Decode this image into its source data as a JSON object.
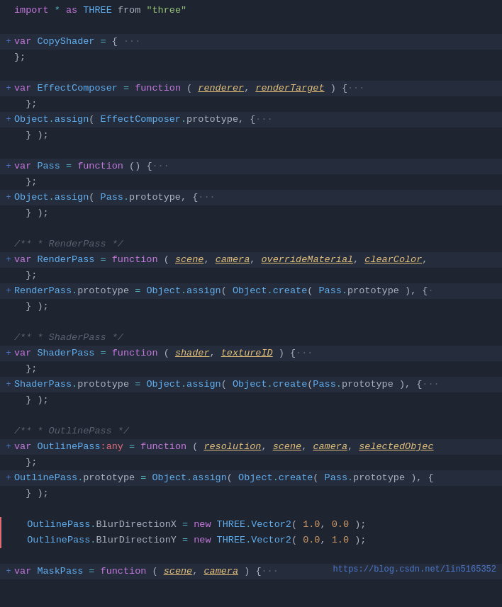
{
  "editor": {
    "background": "#1e2430",
    "lines": [
      {
        "id": "line-1",
        "toggle": "",
        "content": "import_keyword",
        "highlighted": false
      }
    ],
    "url": "https://blog.csdn.net/lin5165352"
  }
}
